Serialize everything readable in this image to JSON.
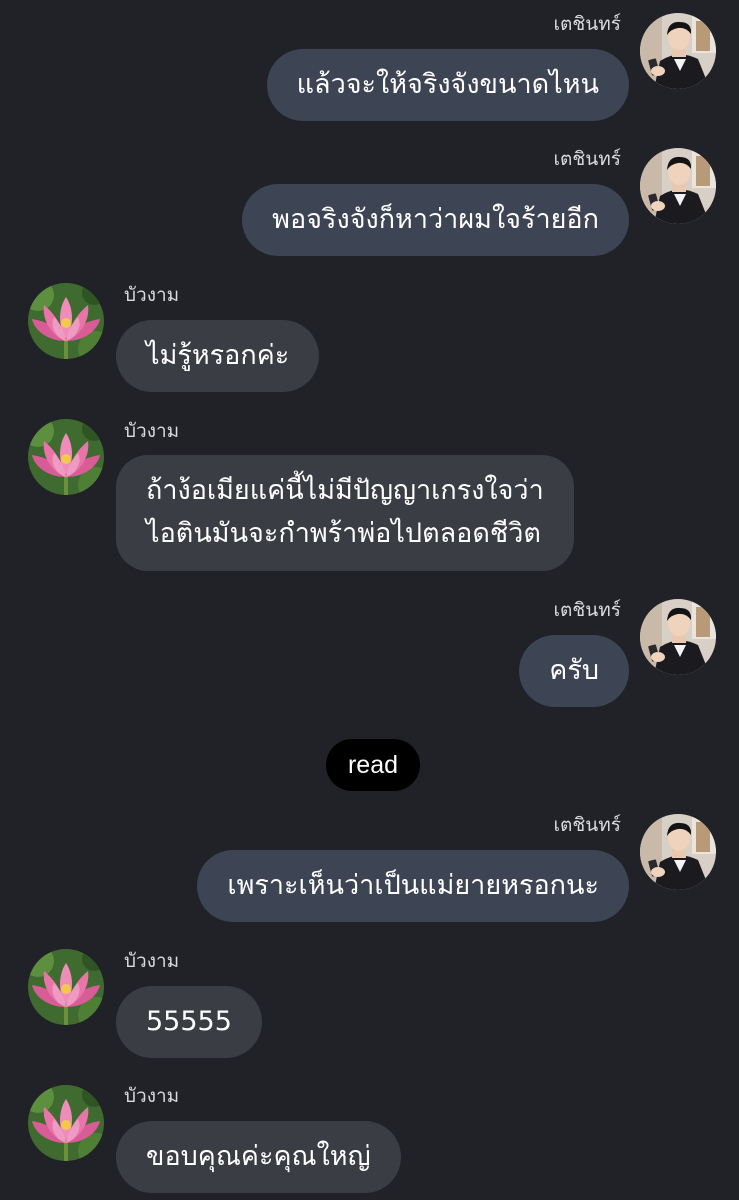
{
  "chat": {
    "participants": {
      "me": {
        "name": "เตชินทร์",
        "avatar_icon": "man-in-suit-avatar-icon"
      },
      "them": {
        "name": "บัวงาม",
        "avatar_icon": "pink-lotus-avatar-icon"
      }
    },
    "messages": [
      {
        "from": "me",
        "sender": "เตชินทร์",
        "text": "แล้วจะให้จริงจังขนาดไหน"
      },
      {
        "from": "me",
        "sender": "เตชินทร์",
        "text": "พอจริงจังก็หาว่าผมใจร้ายอีก"
      },
      {
        "from": "them",
        "sender": "บัวงาม",
        "text": "ไม่รู้หรอกค่ะ"
      },
      {
        "from": "them",
        "sender": "บัวงาม",
        "lines": [
          "ถ้าง้อเมียแค่นี้ไม่มีปัญญาเกรงใจว่า",
          "ไอตินมันจะกำพร้าพ่อไปตลอดชีวิต"
        ]
      },
      {
        "from": "me",
        "sender": "เตชินทร์",
        "text": "ครับ"
      },
      {
        "from": "me",
        "sender": "เตชินทร์",
        "text": "เพราะเห็นว่าเป็นแม่ยายหรอกนะ"
      },
      {
        "from": "them",
        "sender": "บัวงาม",
        "text": "55555"
      },
      {
        "from": "them",
        "sender": "บัวงาม",
        "text": "ขอบคุณค่ะคุณใหญ่"
      }
    ],
    "read_label": "read"
  },
  "colors": {
    "background": "#202228",
    "outgoing_bubble": "#3d4454",
    "incoming_bubble": "#3b3d44",
    "read_pill": "#000000",
    "text": "#ffffff",
    "sender_name": "#d9dbe0"
  }
}
